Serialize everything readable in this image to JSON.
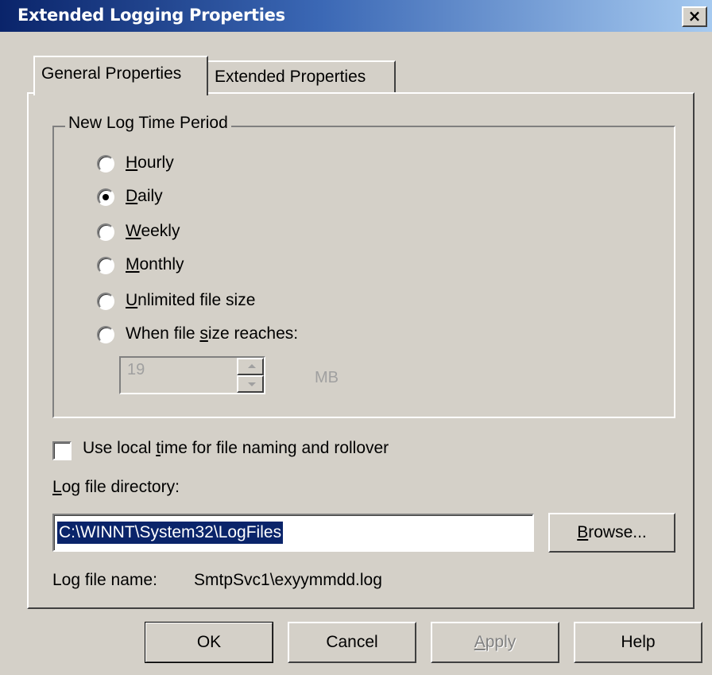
{
  "window": {
    "title": "Extended Logging Properties",
    "close_glyph": "×"
  },
  "tabs": [
    {
      "label": "General Properties",
      "active": true
    },
    {
      "label": "Extended Properties",
      "active": false
    }
  ],
  "log_period": {
    "group_label": "New Log Time Period",
    "options": [
      {
        "label": "Hourly",
        "mnemonic_index": 0,
        "selected": false
      },
      {
        "label": "Daily",
        "mnemonic_index": 0,
        "selected": true
      },
      {
        "label": "Weekly",
        "mnemonic_index": 0,
        "selected": false
      },
      {
        "label": "Monthly",
        "mnemonic_index": 0,
        "selected": false
      },
      {
        "label": "Unlimited file size",
        "mnemonic_index": 0,
        "selected": false
      },
      {
        "label": "When file size reaches:",
        "mnemonic_index": 10,
        "selected": false
      }
    ],
    "size_value": "19",
    "size_unit": "MB"
  },
  "local_time": {
    "label": "Use local time for file naming and rollover",
    "checked": false
  },
  "directory": {
    "label": "Log file directory:",
    "value": "C:\\WINNT\\System32\\LogFiles",
    "browse_label": "Browse..."
  },
  "file_name": {
    "label": "Log file name:",
    "value": "SmtpSvc1\\exyymmdd.log"
  },
  "buttons": {
    "ok": "OK",
    "cancel": "Cancel",
    "apply": "Apply",
    "help": "Help"
  }
}
